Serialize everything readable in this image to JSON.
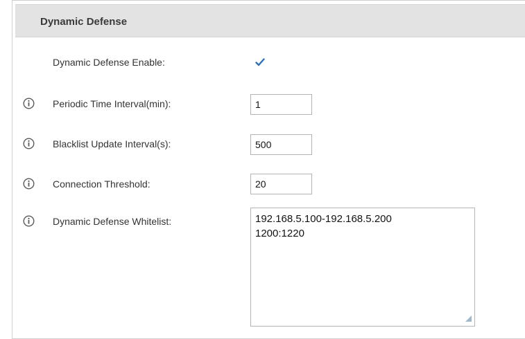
{
  "section": {
    "title": "Dynamic Defense"
  },
  "fields": {
    "enable": {
      "label": "Dynamic Defense Enable:",
      "checked": true
    },
    "periodic_interval": {
      "label": "Periodic Time Interval(min):",
      "value": "1",
      "info_icon": "info-icon"
    },
    "blacklist_interval": {
      "label": "Blacklist Update Interval(s):",
      "value": "500",
      "info_icon": "info-icon"
    },
    "connection_threshold": {
      "label": "Connection Threshold:",
      "value": "20",
      "info_icon": "info-icon"
    },
    "whitelist": {
      "label": "Dynamic Defense Whitelist:",
      "lines": [
        "192.168.5.100-192.168.5.200",
        "1200:1220"
      ],
      "info_icon": "info-icon"
    }
  },
  "colors": {
    "header_bg": "#e3e3e3",
    "checkmark": "#2f6fb5",
    "info_icon": "#5a5a5a"
  }
}
